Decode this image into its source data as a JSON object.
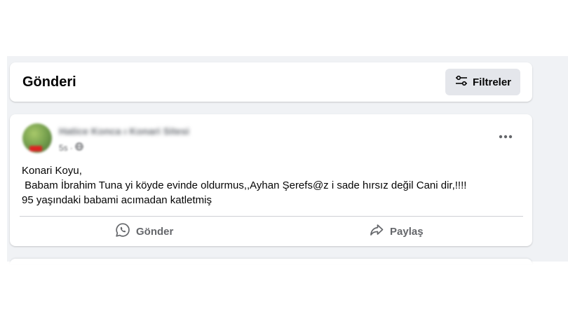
{
  "header": {
    "title": "Gönderi",
    "filter_label": "Filtreler",
    "filter_icon": "sliders-icon"
  },
  "post": {
    "author": "Hatice Konca ı Konari Sitesi",
    "time": "5s",
    "privacy_icon": "globe-icon",
    "more_icon": "more-dots-icon",
    "text": "Konari Koyu,\n Babam İbrahim Tuna yi köyde evinde oldurmus,,Ayhan Şerefs@z i sade hırsız değil Cani dir,!!!!\n95 yaşındaki babami acımadan katletmiş",
    "actions": [
      {
        "label": "Gönder",
        "icon": "whatsapp-icon"
      },
      {
        "label": "Paylaş",
        "icon": "share-arrow-icon"
      }
    ]
  },
  "colors": {
    "feed_background": "#f0f2f5",
    "card": "#ffffff",
    "button_gray": "#e4e6eb",
    "secondary_text": "#65676b",
    "primary_text": "#050505"
  }
}
